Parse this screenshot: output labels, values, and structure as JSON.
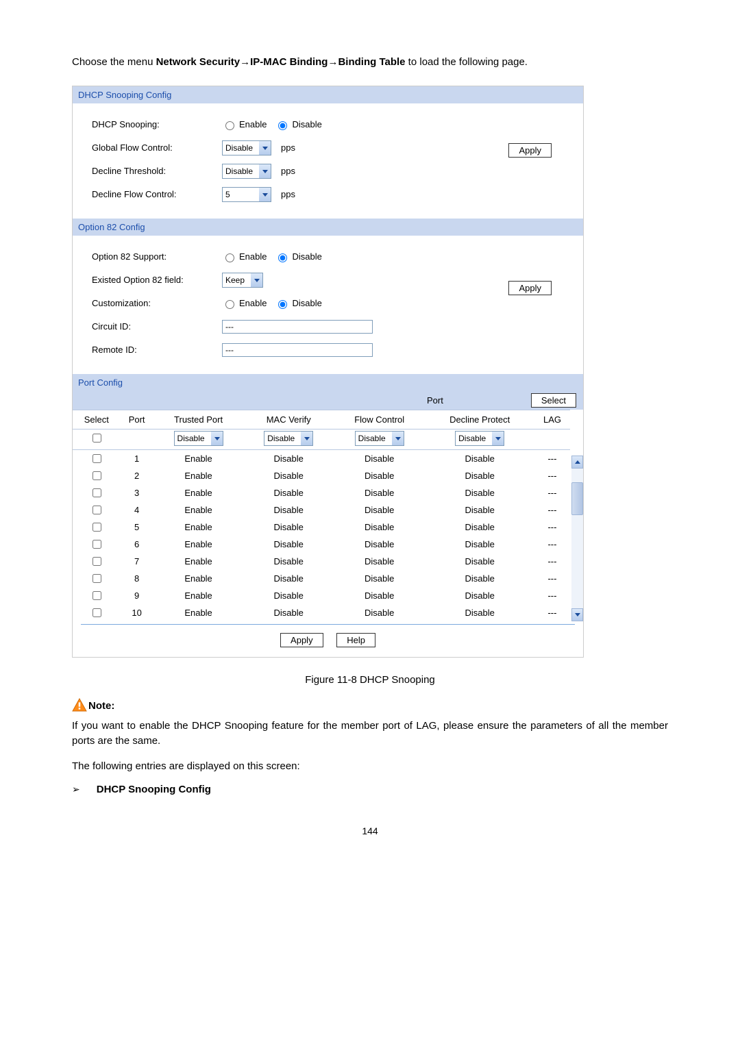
{
  "intro": {
    "prefix": "Choose the menu ",
    "path1": "Network Security",
    "arrow": "→",
    "path2": "IP-MAC Binding",
    "path3": "Binding Table",
    "suffix": " to load the following page."
  },
  "dhcp": {
    "header": "DHCP Snooping Config",
    "fields": {
      "snooping": "DHCP Snooping:",
      "gfc": "Global Flow Control:",
      "decthr": "Decline Threshold:",
      "decflow": "Decline Flow Control:"
    },
    "radio": {
      "enable": "Enable",
      "disable": "Disable"
    },
    "selects": {
      "gfc": "Disable",
      "decthr": "Disable",
      "decflow": "5"
    },
    "unit": "pps",
    "apply": "Apply"
  },
  "opt82": {
    "header": "Option 82 Config",
    "fields": {
      "support": "Option 82 Support:",
      "existed": "Existed Option 82 field:",
      "custom": "Customization:",
      "circuit": "Circuit ID:",
      "remote": "Remote ID:"
    },
    "existedSel": "Keep",
    "apply": "Apply",
    "text": {
      "circuit": "---",
      "remote": "---"
    }
  },
  "portcfg": {
    "header": "Port Config",
    "toolbar": {
      "label": "Port",
      "select": "Select"
    },
    "cols": [
      "Select",
      "Port",
      "Trusted Port",
      "MAC Verify",
      "Flow Control",
      "Decline Protect",
      "LAG"
    ],
    "filterSel": "Disable",
    "rows": [
      {
        "port": "1",
        "trusted": "Enable",
        "mac": "Disable",
        "flow": "Disable",
        "dec": "Disable",
        "lag": "---"
      },
      {
        "port": "2",
        "trusted": "Enable",
        "mac": "Disable",
        "flow": "Disable",
        "dec": "Disable",
        "lag": "---"
      },
      {
        "port": "3",
        "trusted": "Enable",
        "mac": "Disable",
        "flow": "Disable",
        "dec": "Disable",
        "lag": "---"
      },
      {
        "port": "4",
        "trusted": "Enable",
        "mac": "Disable",
        "flow": "Disable",
        "dec": "Disable",
        "lag": "---"
      },
      {
        "port": "5",
        "trusted": "Enable",
        "mac": "Disable",
        "flow": "Disable",
        "dec": "Disable",
        "lag": "---"
      },
      {
        "port": "6",
        "trusted": "Enable",
        "mac": "Disable",
        "flow": "Disable",
        "dec": "Disable",
        "lag": "---"
      },
      {
        "port": "7",
        "trusted": "Enable",
        "mac": "Disable",
        "flow": "Disable",
        "dec": "Disable",
        "lag": "---"
      },
      {
        "port": "8",
        "trusted": "Enable",
        "mac": "Disable",
        "flow": "Disable",
        "dec": "Disable",
        "lag": "---"
      },
      {
        "port": "9",
        "trusted": "Enable",
        "mac": "Disable",
        "flow": "Disable",
        "dec": "Disable",
        "lag": "---"
      },
      {
        "port": "10",
        "trusted": "Enable",
        "mac": "Disable",
        "flow": "Disable",
        "dec": "Disable",
        "lag": "---"
      }
    ],
    "buttons": {
      "apply": "Apply",
      "help": "Help"
    }
  },
  "figcap": "Figure 11-8 DHCP Snooping",
  "note": {
    "label": "Note:",
    "text": "If you want to enable the DHCP Snooping feature for the member port of LAG, please ensure the parameters of all the member ports are the same."
  },
  "entries": "The following entries are displayed on this screen:",
  "bullet": {
    "sym": "➢",
    "text": "DHCP Snooping Config"
  },
  "pagenum": "144"
}
